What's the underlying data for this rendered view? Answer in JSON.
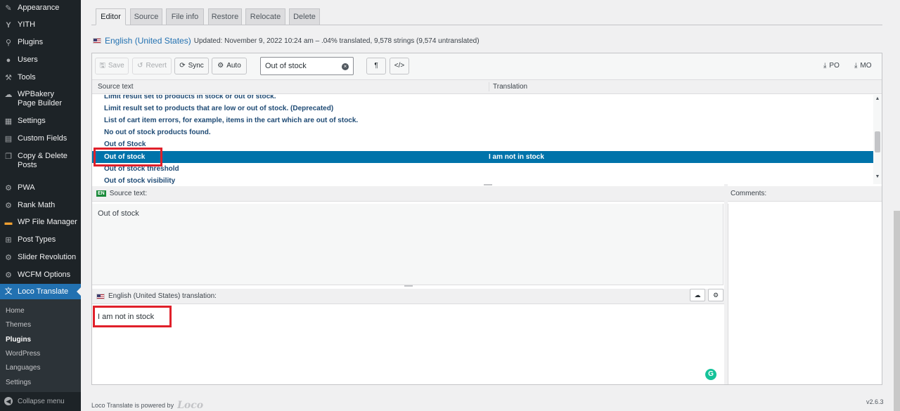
{
  "sidebar": {
    "items": [
      {
        "icon": "paintbrush-icon",
        "label": "Appearance"
      },
      {
        "icon": "yith-icon",
        "label": "YITH"
      },
      {
        "icon": "plugin-icon",
        "label": "Plugins"
      },
      {
        "icon": "users-icon",
        "label": "Users"
      },
      {
        "icon": "wrench-icon",
        "label": "Tools"
      },
      {
        "icon": "wpbakery-icon",
        "label": "WPBakery Page Builder"
      },
      {
        "icon": "settings-icon",
        "label": "Settings"
      },
      {
        "icon": "custom-fields-icon",
        "label": "Custom Fields"
      },
      {
        "icon": "copy-icon",
        "label": "Copy & Delete Posts"
      },
      {
        "icon": "gear-icon",
        "label": "PWA"
      },
      {
        "icon": "gear-icon",
        "label": "Rank Math"
      },
      {
        "icon": "folder-icon",
        "label": "WP File Manager"
      },
      {
        "icon": "grid-icon",
        "label": "Post Types"
      },
      {
        "icon": "slider-icon",
        "label": "Slider Revolution"
      },
      {
        "icon": "gear-icon",
        "label": "WCFM Options"
      },
      {
        "icon": "translate-icon",
        "label": "Loco Translate"
      }
    ],
    "submenu": [
      "Home",
      "Themes",
      "Plugins",
      "WordPress",
      "Languages",
      "Settings"
    ],
    "submenu_current": "Plugins",
    "collapse_label": "Collapse menu"
  },
  "tabs": [
    "Editor",
    "Source",
    "File info",
    "Restore",
    "Relocate",
    "Delete"
  ],
  "active_tab": "Editor",
  "info": {
    "language": "English (United States)",
    "details": "Updated: November 9, 2022 10:24 am – .04% translated, 9,578 strings (9,574 untranslated)"
  },
  "toolbar": {
    "save": "Save",
    "revert": "Revert",
    "sync": "Sync",
    "auto": "Auto",
    "search_value": "Out of stock",
    "pilcrow": "¶",
    "code": "</>",
    "po": "PO",
    "mo": "MO"
  },
  "list": {
    "col_source": "Source text",
    "col_translation": "Translation",
    "rows": [
      {
        "source": "Limit result set to products in stock or out of stock.",
        "translation": ""
      },
      {
        "source": "Limit result set to products that are low or out of stock. (Deprecated)",
        "translation": ""
      },
      {
        "source": "List of cart item errors, for example, items in the cart which are out of stock.",
        "translation": ""
      },
      {
        "source": "No out of stock products found.",
        "translation": ""
      },
      {
        "source": "Out of Stock",
        "translation": ""
      },
      {
        "source": "Out of stock",
        "translation": "I am not in stock"
      },
      {
        "source": "Out of stock threshold",
        "translation": ""
      },
      {
        "source": "Out of stock visibility",
        "translation": ""
      }
    ]
  },
  "source_pane": {
    "badge": "EN",
    "label": "Source text:",
    "text": "Out of stock"
  },
  "comments_label": "Comments:",
  "translation_pane": {
    "label": "English (United States) translation:",
    "text": "I am not in stock"
  },
  "footer": {
    "powered": "Loco Translate is powered by",
    "logo": "Loco",
    "version": "v2.6.3"
  },
  "colors": {
    "accent": "#2271b1",
    "selected_row": "#0073aa",
    "highlight": "#e0202a",
    "sidebar_bg": "#1d2327"
  }
}
